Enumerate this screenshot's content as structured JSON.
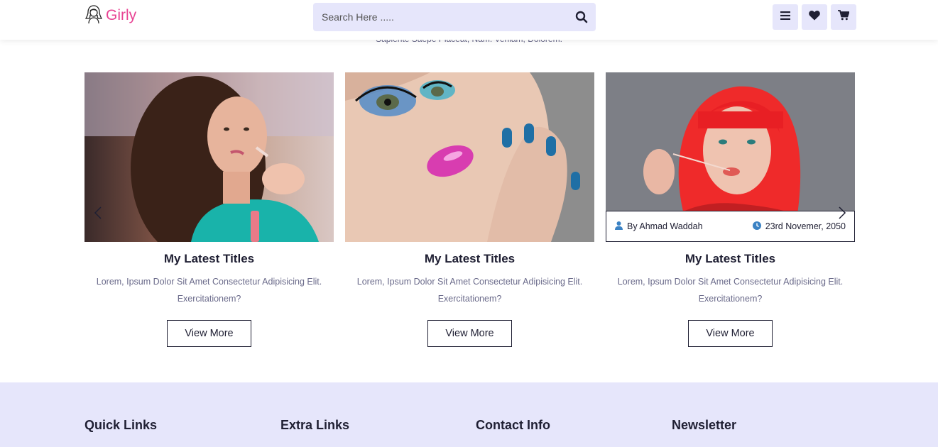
{
  "header": {
    "logo_text": "Girly",
    "search_placeholder": "Search Here .....",
    "icons": [
      "menu-icon",
      "heart-icon",
      "cart-icon"
    ]
  },
  "section": {
    "tagline": "Sapiente Saepe Placeat, Nam. Veniam, Dolorem."
  },
  "cards": [
    {
      "title": "My Latest Titles",
      "description": "Lorem, Ipsum Dolor Sit Amet Consectetur Adipisicing Elit. Exercitationem?",
      "button": "View More"
    },
    {
      "title": "My Latest Titles",
      "description": "Lorem, Ipsum Dolor Sit Amet Consectetur Adipisicing Elit. Exercitationem?",
      "button": "View More"
    },
    {
      "title": "My Latest Titles",
      "description": "Lorem, Ipsum Dolor Sit Amet Consectetur Adipisicing Elit. Exercitationem?",
      "button": "View More",
      "author": "By Ahmad Waddah",
      "date": "23rd Novemer, 2050"
    }
  ],
  "footer": {
    "columns": [
      "Quick Links",
      "Extra Links",
      "Contact Info",
      "Newsletter"
    ]
  },
  "colors": {
    "brand_pink": "#e84393",
    "lavender": "#e6e6fb",
    "dark": "#1f1f33",
    "muted_text": "#6a6a8a",
    "meta_icon_blue": "#3b82c4"
  }
}
